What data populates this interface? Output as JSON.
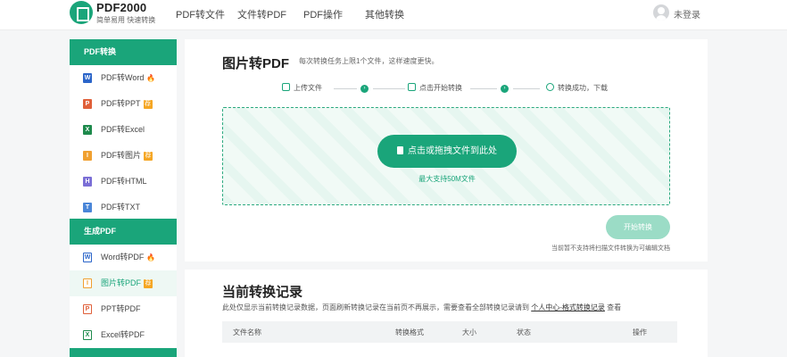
{
  "header": {
    "brand_title": "PDF2000",
    "brand_sub": "简单易用 快速转换",
    "nav": [
      "PDF转文件",
      "文件转PDF",
      "PDF操作",
      "其他转换"
    ],
    "login": "未登录"
  },
  "sidebar": {
    "section1": "PDF转换",
    "items1": [
      {
        "label": "PDF转Word",
        "icon": "W",
        "color": "#2b65c9",
        "badge": "fire"
      },
      {
        "label": "PDF转PPT",
        "icon": "P",
        "color": "#e0603a",
        "badge": "tag"
      },
      {
        "label": "PDF转Excel",
        "icon": "X",
        "color": "#1e8a4c",
        "badge": ""
      },
      {
        "label": "PDF转图片",
        "icon": "I",
        "color": "#f0a030",
        "badge": "tag"
      },
      {
        "label": "PDF转HTML",
        "icon": "H",
        "color": "#7b6fd6",
        "badge": ""
      },
      {
        "label": "PDF转TXT",
        "icon": "T",
        "color": "#4a86d8",
        "badge": ""
      }
    ],
    "section2": "生成PDF",
    "items2": [
      {
        "label": "Word转PDF",
        "icon": "W",
        "color": "#2b65c9",
        "badge": "fire"
      },
      {
        "label": "图片转PDF",
        "icon": "I",
        "color": "#f0a030",
        "badge": "tag"
      },
      {
        "label": "PPT转PDF",
        "icon": "P",
        "color": "#e0603a",
        "badge": ""
      },
      {
        "label": "Excel转PDF",
        "icon": "X",
        "color": "#1e8a4c",
        "badge": ""
      }
    ],
    "tag_text": "荐",
    "fire_glyph": "🔥"
  },
  "upload": {
    "title": "图片转PDF",
    "subtitle": "每次转换任务上限1个文件，这样速度更快。",
    "steps": [
      "上传文件",
      "点击开始转换",
      "转换成功，下载"
    ],
    "button": "点击或拖拽文件到此处",
    "max": "最大支持50M文件",
    "start": "开始转换",
    "note": "当前暂不支持将扫描文件转换为可编辑文档"
  },
  "records": {
    "title": "当前转换记录",
    "desc": "此处仅显示当前转换记录数据，页面刷新转换记录在当前页不再展示，需要查看全部转换记录请到",
    "link": "个人中心-格式转换记录",
    "desc_tail": "查看",
    "columns": [
      "文件名称",
      "转换格式",
      "大小",
      "状态",
      "操作"
    ]
  },
  "colors": {
    "accent": "#1aa57a",
    "accent_light": "#9bdcc6"
  }
}
